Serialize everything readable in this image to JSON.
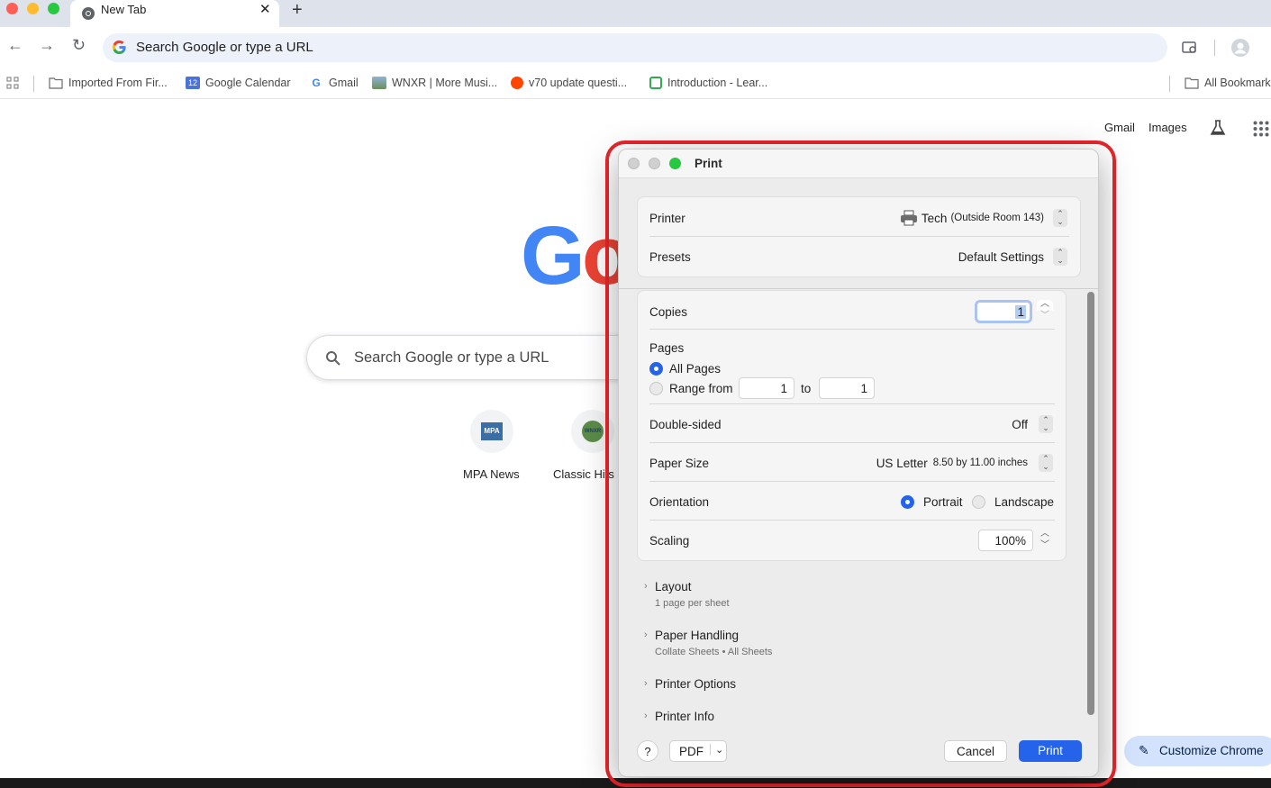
{
  "browser": {
    "tab_title": "New Tab",
    "tab_close": "✕",
    "new_tab": "+",
    "omnibox_text": "Search Google or type a URL",
    "bookmarks": [
      {
        "label": "Imported From Fir...",
        "icon": "folder-icon"
      },
      {
        "label": "Google Calendar",
        "icon": "calendar-icon"
      },
      {
        "label": "Gmail",
        "icon": "google-icon"
      },
      {
        "label": "WNXR | More Musi...",
        "icon": "wnxr-icon"
      },
      {
        "label": "v70 update questi...",
        "icon": "reddit-icon"
      },
      {
        "label": "Introduction - Lear...",
        "icon": "learn-icon"
      }
    ],
    "all_bookmarks": "All Bookmark",
    "calendar_day": "12"
  },
  "newtab": {
    "links": {
      "gmail": "Gmail",
      "images": "Images"
    },
    "logo_g": "G",
    "logo_o": "o",
    "search_placeholder": "Search Google or type a URL",
    "shortcuts": [
      {
        "label": "MPA News",
        "icon_text": "MPA"
      },
      {
        "label": "Classic Hits",
        "icon_text": "WNXR"
      }
    ],
    "customize_label": "Customize Chrome"
  },
  "print_dialog": {
    "title": "Print",
    "printer_label": "Printer",
    "printer_name": "Tech",
    "printer_location": "(Outside Room 143)",
    "presets_label": "Presets",
    "presets_value": "Default Settings",
    "copies_label": "Copies",
    "copies_value": "1",
    "pages_label": "Pages",
    "all_pages": "All Pages",
    "range_from": "Range from",
    "range_start": "1",
    "range_to": "to",
    "range_end": "1",
    "pages_selected": "All Pages",
    "double_sided_label": "Double-sided",
    "double_sided_value": "Off",
    "paper_size_label": "Paper Size",
    "paper_size_value": "US Letter",
    "paper_size_dims": "8.50 by 11.00 inches",
    "orientation_label": "Orientation",
    "orientation_portrait": "Portrait",
    "orientation_landscape": "Landscape",
    "orientation_selected": "Portrait",
    "scaling_label": "Scaling",
    "scaling_value": "100%",
    "sections": [
      {
        "title": "Layout",
        "subtitle": "1 page per sheet"
      },
      {
        "title": "Paper Handling",
        "subtitle": "Collate Sheets • All Sheets"
      },
      {
        "title": "Printer Options",
        "subtitle": ""
      },
      {
        "title": "Printer Info",
        "subtitle": ""
      }
    ],
    "help": "?",
    "pdf": "PDF",
    "cancel": "Cancel",
    "print": "Print"
  },
  "colors": {
    "accent": "#2563eb",
    "highlight_frame": "#e8262b",
    "google_blue": "#4285f4",
    "google_red": "#ea4335"
  }
}
